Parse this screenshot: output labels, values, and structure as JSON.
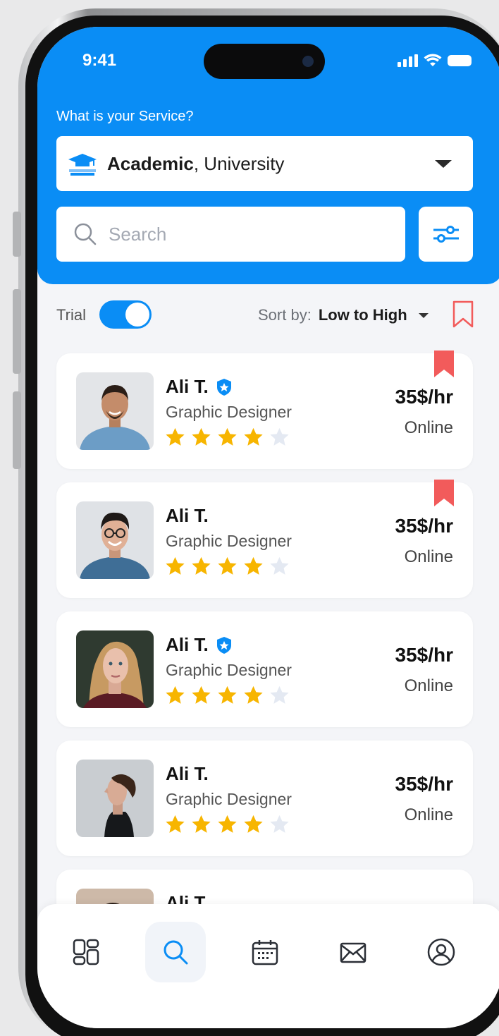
{
  "status_bar": {
    "time": "9:41"
  },
  "header": {
    "service_label": "What is your Service?",
    "service_bold": "Academic",
    "service_rest": ", University",
    "search_placeholder": "Search"
  },
  "controls": {
    "trial_label": "Trial",
    "trial_enabled": true,
    "sort_label": "Sort by:",
    "sort_value": "Low to High"
  },
  "colors": {
    "accent": "#0a8df5",
    "star": "#f7b500",
    "bookmark": "#f25b5b"
  },
  "tutors": [
    {
      "name": "Ali T.",
      "verified": true,
      "role": "Graphic Designer",
      "rating": 4,
      "max_rating": 5,
      "price": "35$/hr",
      "status": "Online",
      "bookmarked": true
    },
    {
      "name": "Ali T.",
      "verified": false,
      "role": "Graphic Designer",
      "rating": 4,
      "max_rating": 5,
      "price": "35$/hr",
      "status": "Online",
      "bookmarked": true
    },
    {
      "name": "Ali T.",
      "verified": true,
      "role": "Graphic Designer",
      "rating": 4,
      "max_rating": 5,
      "price": "35$/hr",
      "status": "Online",
      "bookmarked": false
    },
    {
      "name": "Ali T.",
      "verified": false,
      "role": "Graphic Designer",
      "rating": 4,
      "max_rating": 5,
      "price": "35$/hr",
      "status": "Online",
      "bookmarked": false
    },
    {
      "name": "Ali T.",
      "verified": false,
      "role": "",
      "rating": 0,
      "max_rating": 5,
      "price": "",
      "status": "",
      "bookmarked": false
    }
  ],
  "nav": [
    {
      "icon": "dashboard-icon",
      "active": false
    },
    {
      "icon": "search-icon",
      "active": true
    },
    {
      "icon": "calendar-icon",
      "active": false
    },
    {
      "icon": "mail-icon",
      "active": false
    },
    {
      "icon": "profile-icon",
      "active": false
    }
  ]
}
